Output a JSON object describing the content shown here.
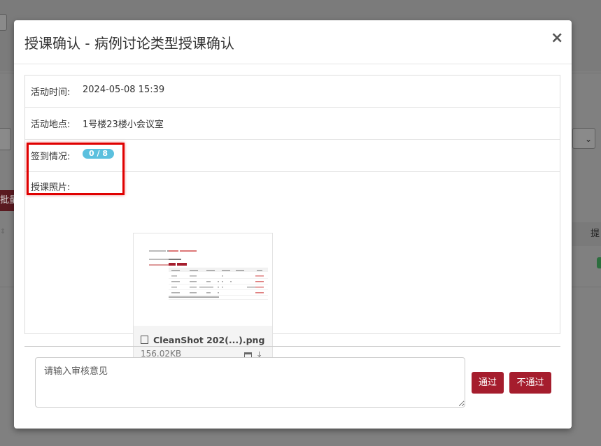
{
  "modal": {
    "title": "授课确认 - 病例讨论类型授课确认",
    "close_glyph": "×",
    "activity_time_label": "活动时间:",
    "activity_time": "2024-05-08 15:39",
    "location_label": "活动地点:",
    "location": "1号楼23楼小会议室",
    "checkin_label": "签到情况:",
    "checkin_badge": "0 / 8",
    "photo_label": "授课照片:",
    "file": {
      "name": "CleanShot 202(...).png",
      "size": "156.02KB",
      "icons": [
        "image-icon",
        "calendar-icon",
        "download-icon"
      ]
    },
    "review": {
      "placeholder": "请输入审核意见",
      "value": ""
    },
    "buttons": {
      "pass": "通过",
      "reject": "不通过"
    }
  },
  "background": {
    "batch_button": "批量",
    "table_header_partial": "提"
  },
  "colors": {
    "primary_button": "#a51d2d",
    "badge": "#5bc0de",
    "highlight": "#e00000"
  }
}
